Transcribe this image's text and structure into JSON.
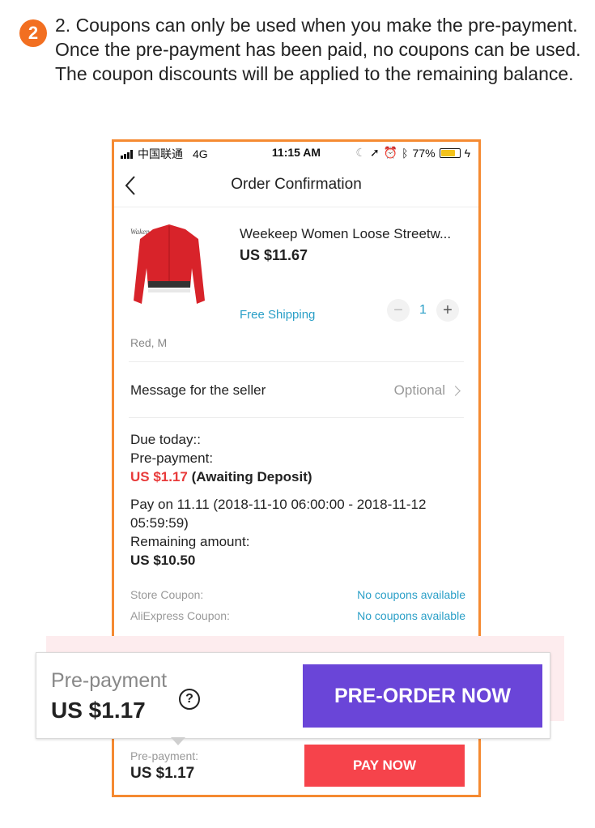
{
  "step": {
    "number": "2",
    "text": "2. Coupons can only be used when you make the pre-payment. Once the pre-payment has been paid, no coupons can be used. The coupon discounts will be applied to the remaining balance."
  },
  "status_bar": {
    "carrier": "中国联通",
    "network": "4G",
    "time": "11:15 AM",
    "battery": "77%",
    "battery_level": 0.77,
    "battery_color": "#f3c31b"
  },
  "nav": {
    "title": "Order Confirmation",
    "back_icon": "chevron-left-icon"
  },
  "product": {
    "name": "Weekeep Women Loose Streetw...",
    "price": "US $11.67",
    "shipping": "Free Shipping",
    "quantity": "1",
    "variant": "Red, M",
    "image_icon": "red-jacket-image"
  },
  "message": {
    "label": "Message for the seller",
    "placeholder": "Optional"
  },
  "payment": {
    "due_today": "Due today::",
    "prepayment_label": "Pre-payment:",
    "prepayment_amount": "US $1.17",
    "prepayment_status": "(Awaiting Deposit)",
    "pay_on": "Pay on 11.11 (2018-11-10 06:00:00 - 2018-11-12 05:59:59)",
    "remaining_label": "Remaining amount:",
    "remaining_amount": "US $10.50"
  },
  "coupons": {
    "store_label": "Store Coupon:",
    "store_value": "No coupons available",
    "aliexpress_label": "AliExpress Coupon:",
    "aliexpress_value": "No coupons available"
  },
  "popup": {
    "label": "Pre-payment",
    "amount": "US $1.17",
    "help": "?",
    "button": "PRE-ORDER NOW"
  },
  "bottom_bar": {
    "label": "Pre-payment:",
    "amount": "US $1.17",
    "button": "PAY NOW"
  },
  "colors": {
    "accent_orange": "#f26f21",
    "frame_orange": "#f58a32",
    "link_blue": "#2a9fc7",
    "price_red": "#e83a3a",
    "preorder_purple": "#6a45d8",
    "pay_red": "#f6434b"
  }
}
